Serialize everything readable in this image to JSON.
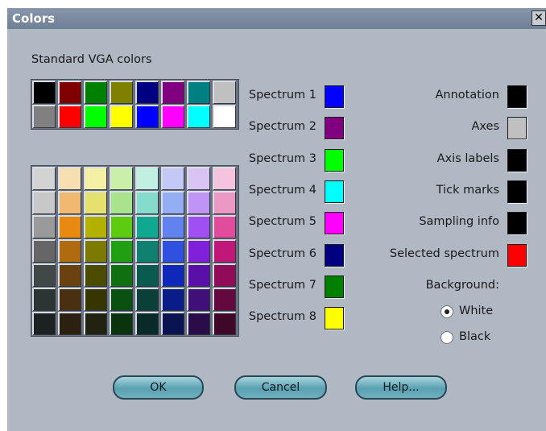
{
  "window": {
    "title": "Colors",
    "close_glyph": "✕"
  },
  "standard_label": "Standard VGA colors",
  "standard_colors": [
    [
      "#000000",
      "#800000",
      "#008000",
      "#808000",
      "#000080",
      "#800080",
      "#008080",
      "#c0c0c0"
    ],
    [
      "#808080",
      "#ff0000",
      "#00ff00",
      "#ffff00",
      "#0000ff",
      "#ff00ff",
      "#00ffff",
      "#ffffff"
    ]
  ],
  "custom_colors": [
    [
      "#d3d3d3",
      "#f7dfb2",
      "#f4f0a6",
      "#c8f0a8",
      "#bff0e2",
      "#c4c8f6",
      "#dac4f6",
      "#f4c4dc"
    ],
    [
      "#c8c8c8",
      "#f0b870",
      "#e6e06c",
      "#a8e48c",
      "#86dccc",
      "#94aef4",
      "#c094f4",
      "#ec98c4"
    ],
    [
      "#9a9a9a",
      "#e88a10",
      "#b4b000",
      "#5ccc10",
      "#10a890",
      "#6282f0",
      "#a050f0",
      "#e24c9c"
    ],
    [
      "#666666",
      "#b06a10",
      "#7c7a00",
      "#20a010",
      "#108070",
      "#3050e0",
      "#8020d8",
      "#c01878"
    ],
    [
      "#404848",
      "#6a4210",
      "#4c4c00",
      "#107010",
      "#0a5a50",
      "#1028b8",
      "#5a10a8",
      "#900c58"
    ],
    [
      "#2c3434",
      "#4a3010",
      "#363600",
      "#0a5010",
      "#0a4038",
      "#0a1c88",
      "#401078",
      "#640840"
    ],
    [
      "#1c2222",
      "#2c2010",
      "#222210",
      "#0a3410",
      "#0a2a28",
      "#0a1450",
      "#2a0c48",
      "#400828"
    ]
  ],
  "spectra": [
    {
      "label": "Spectrum 1",
      "color": "#0000ff"
    },
    {
      "label": "Spectrum 2",
      "color": "#800080"
    },
    {
      "label": "Spectrum 3",
      "color": "#00ff00"
    },
    {
      "label": "Spectrum 4",
      "color": "#00ffff"
    },
    {
      "label": "Spectrum 5",
      "color": "#ff00ff"
    },
    {
      "label": "Spectrum 6",
      "color": "#000080"
    },
    {
      "label": "Spectrum 7",
      "color": "#008000"
    },
    {
      "label": "Spectrum 8",
      "color": "#ffff00"
    }
  ],
  "elements": [
    {
      "label": "Annotation",
      "color": "#000000"
    },
    {
      "label": "Axes",
      "color": "#c0c0c0"
    },
    {
      "label": "Axis labels",
      "color": "#000000"
    },
    {
      "label": "Tick marks",
      "color": "#000000"
    },
    {
      "label": "Sampling info",
      "color": "#000000"
    },
    {
      "label": "Selected spectrum",
      "color": "#ff0000"
    }
  ],
  "background": {
    "label": "Background:",
    "options": [
      {
        "label": "White",
        "selected": true
      },
      {
        "label": "Black",
        "selected": false
      }
    ]
  },
  "buttons": {
    "ok": "OK",
    "cancel": "Cancel",
    "help": "Help..."
  }
}
